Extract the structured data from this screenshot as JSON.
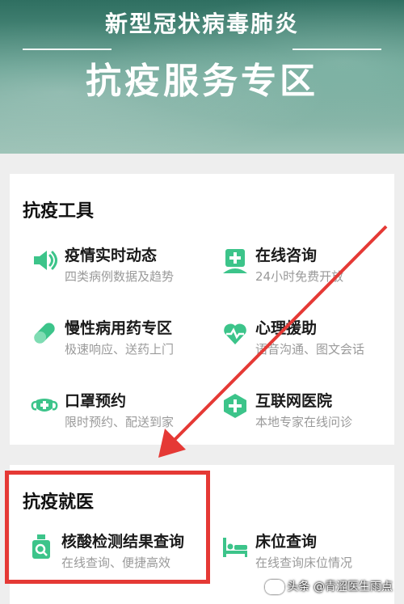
{
  "banner": {
    "subtitle": "新型冠状病毒肺炎",
    "title": "抗疫服务专区"
  },
  "tools": {
    "section_title": "抗疫工具",
    "items": [
      {
        "title": "疫情实时动态",
        "desc": "四类病例数据及趋势",
        "icon": "speaker-icon"
      },
      {
        "title": "在线咨询",
        "desc": "24小时免费开放",
        "icon": "doctor-icon"
      },
      {
        "title": "慢性病用药专区",
        "desc": "极速响应、送药上门",
        "icon": "pill-icon"
      },
      {
        "title": "心理援助",
        "desc": "语音沟通、图文会话",
        "icon": "heart-pulse-icon"
      },
      {
        "title": "口罩预约",
        "desc": "限时预约、配送到家",
        "icon": "mask-icon"
      },
      {
        "title": "互联网医院",
        "desc": "本地专家在线问诊",
        "icon": "medical-cross-icon"
      }
    ]
  },
  "medical": {
    "section_title": "抗疫就医",
    "items": [
      {
        "title": "核酸检测结果查询",
        "desc": "在线查询、便捷高效",
        "icon": "test-bottle-icon"
      },
      {
        "title": "床位查询",
        "desc": "在线查询床位情况",
        "icon": "bed-icon"
      }
    ]
  },
  "watermark": "头条 @青涩医生雨点",
  "colors": {
    "accent": "#3cc48a",
    "highlight": "#e53935"
  }
}
